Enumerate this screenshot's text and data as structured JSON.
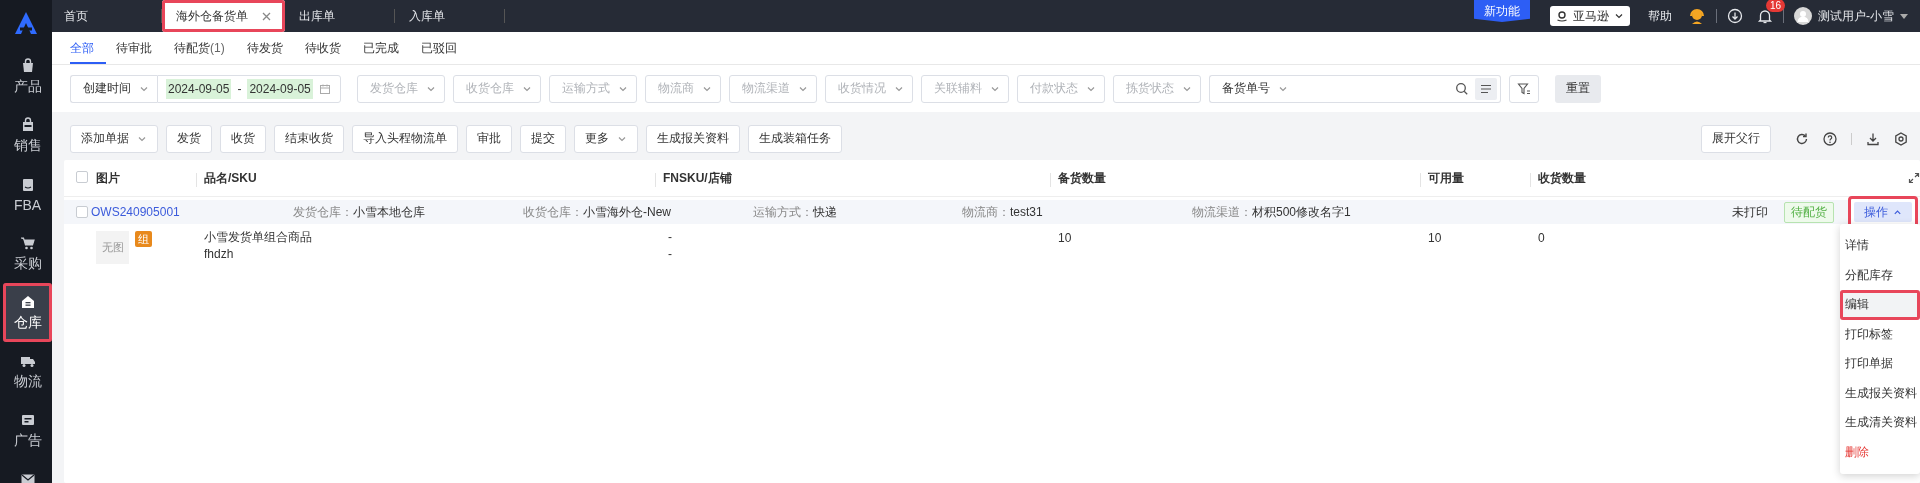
{
  "sidebar": {
    "items": [
      {
        "label": "产品",
        "selected": false,
        "highlighted": false
      },
      {
        "label": "销售",
        "selected": false,
        "highlighted": false
      },
      {
        "label": "FBA",
        "selected": false,
        "highlighted": false
      },
      {
        "label": "采购",
        "selected": false,
        "highlighted": false
      },
      {
        "label": "仓库",
        "selected": true,
        "highlighted": true
      },
      {
        "label": "物流",
        "selected": false,
        "highlighted": false
      },
      {
        "label": "广告",
        "selected": false,
        "highlighted": false
      },
      {
        "selected": false,
        "highlighted": false
      }
    ]
  },
  "top_tabs": [
    {
      "label": "首页",
      "selected": false,
      "closable": false,
      "highlighted": false
    },
    {
      "label": "海外仓备货单",
      "selected": true,
      "closable": true,
      "highlighted": true
    },
    {
      "label": "出库单",
      "selected": false,
      "closable": false,
      "highlighted": false
    },
    {
      "label": "入库单",
      "selected": false,
      "closable": false,
      "highlighted": false
    }
  ],
  "header": {
    "new_feature_badge": "新功能",
    "store_select": "亚马逊",
    "help": "帮助",
    "notification_count": "16",
    "user_name": "测试用户-小雪"
  },
  "status_tabs": [
    {
      "label": "全部",
      "selected": true
    },
    {
      "label": "待审批",
      "selected": false
    },
    {
      "label": "待配货",
      "count": "(1)",
      "selected": false
    },
    {
      "label": "待发货",
      "selected": false
    },
    {
      "label": "待收货",
      "selected": false
    },
    {
      "label": "已完成",
      "selected": false
    },
    {
      "label": "已驳回",
      "selected": false
    }
  ],
  "filters": {
    "time_field": "创建时间",
    "date_start": "2024-09-05",
    "date_separator": "-",
    "date_end": "2024-09-05",
    "dates_highlighted": true,
    "selects": [
      {
        "placeholder": "发货仓库"
      },
      {
        "placeholder": "收货仓库"
      },
      {
        "placeholder": "运输方式"
      },
      {
        "placeholder": "物流商"
      },
      {
        "placeholder": "物流渠道"
      },
      {
        "placeholder": "收货情况"
      },
      {
        "placeholder": "关联辅料"
      },
      {
        "placeholder": "付款状态"
      },
      {
        "placeholder": "拣货状态"
      }
    ],
    "search_field_select": "备货单号",
    "reset_button": "重置"
  },
  "toolbar": {
    "buttons": [
      {
        "label": "添加单据",
        "kind": "dropdown"
      },
      {
        "label": "发货",
        "kind": "plain"
      },
      {
        "label": "收货",
        "kind": "plain"
      },
      {
        "label": "结束收货",
        "kind": "plain"
      },
      {
        "label": "导入头程物流单",
        "kind": "plain"
      },
      {
        "label": "审批",
        "kind": "plain"
      },
      {
        "label": "提交",
        "kind": "plain"
      },
      {
        "label": "更多",
        "kind": "dropdown"
      },
      {
        "label": "生成报关资料",
        "kind": "plain"
      },
      {
        "label": "生成装箱任务",
        "kind": "plain"
      }
    ],
    "expand_button": "展开父行"
  },
  "table": {
    "select_all_checked": false,
    "columns": [
      "图片",
      "品名/SKU",
      "FNSKU/店铺",
      "备货数量",
      "可用量",
      "收货数量"
    ],
    "orders": [
      {
        "order_no": "OWS240905001",
        "checked": false,
        "fields": [
          {
            "label": "发货仓库：",
            "value": "小雪本地仓库"
          },
          {
            "label": "收货仓库：",
            "value": "小雪海外仓-New"
          },
          {
            "label": "运输方式：",
            "value": "快递"
          },
          {
            "label": "物流商：",
            "value": "test31"
          },
          {
            "label": "物流渠道：",
            "value": "材积500修改名字1"
          }
        ],
        "print_status": "未打印",
        "status_tag": "待配货",
        "action_button": {
          "label": "操作",
          "expanded": true,
          "highlighted": true
        },
        "items": [
          {
            "image_placeholder": "无图",
            "tag": "组",
            "name": "小雪发货单组合商品",
            "sku": "fhdzh",
            "fnsku": "-",
            "store": "-",
            "stock_qty": "10",
            "available": "10",
            "received": "0"
          }
        ]
      }
    ]
  },
  "action_menu": {
    "items": [
      {
        "label": "详情",
        "kind": "normal",
        "highlighted": false
      },
      {
        "label": "分配库存",
        "kind": "normal",
        "highlighted": false
      },
      {
        "label": "编辑",
        "kind": "normal",
        "highlighted": true
      },
      {
        "label": "打印标签",
        "kind": "normal",
        "highlighted": false
      },
      {
        "label": "打印单据",
        "kind": "normal",
        "highlighted": false
      },
      {
        "label": "生成报关资料",
        "kind": "normal",
        "highlighted": false
      },
      {
        "label": "生成清关资料",
        "kind": "normal",
        "highlighted": false
      },
      {
        "label": "删除",
        "kind": "danger",
        "highlighted": false
      }
    ]
  }
}
